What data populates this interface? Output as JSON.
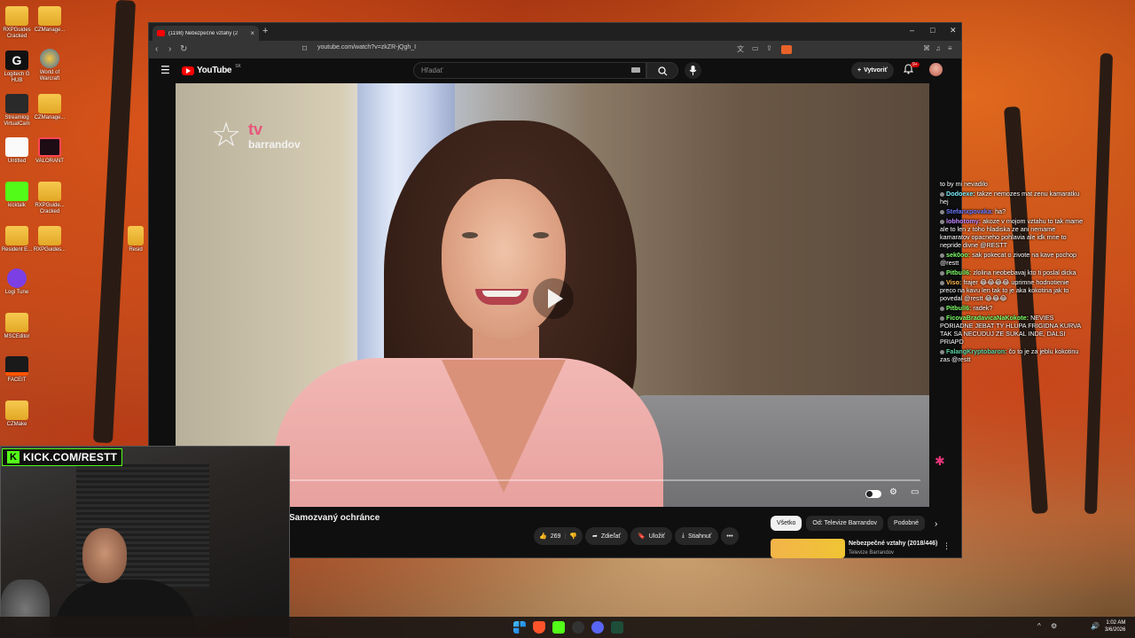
{
  "desktop": {
    "icons": [
      {
        "label": "RXPGuides Cracked"
      },
      {
        "label": "CZManage..."
      },
      {
        "label": "Logitech G HUB"
      },
      {
        "label": "World of Warcraft"
      },
      {
        "label": "Streamlog VirtualCam"
      },
      {
        "label": "CZManage..."
      },
      {
        "label": "Untitled"
      },
      {
        "label": "VALORANT"
      },
      {
        "label": "kicktalk"
      },
      {
        "label": "RXPGuide... Cracked"
      },
      {
        "label": "Resident E..."
      },
      {
        "label": "RXPGuides..."
      },
      {
        "label": "Logi Tune"
      },
      {
        "label": "MSCEditor"
      },
      {
        "label": "FACEIT"
      },
      {
        "label": "CZMake"
      },
      {
        "label": "Resid"
      }
    ]
  },
  "browser": {
    "tab_title": "(1198) Nebezpečné vztahy (2",
    "url": "youtube.com/watch?v=zkZR-jQgh_I"
  },
  "youtube": {
    "logo_text": "YouTube",
    "country_code": "SK",
    "search_placeholder": "Hľadať",
    "create_label": "Vytvoriť",
    "notification_count": "9+",
    "video": {
      "channel_logo_tv": "tv",
      "channel_logo_name": "barrandov",
      "title": "Samozvaný ochránce"
    },
    "actions": {
      "likes": "269",
      "share": "Zdieľať",
      "save": "Uložiť",
      "download": "Stiahnuť"
    },
    "chips": [
      "Všetko",
      "Od: Televize Barrandov",
      "Podobné"
    ],
    "recommendation": {
      "title": "Nebezpečné vztahy (2018/446)",
      "channel": "Televize Barrandov"
    }
  },
  "chat": [
    {
      "user": "",
      "text": "to by mi nevadilo",
      "color": "#ffffff"
    },
    {
      "user": "Dodoexe:",
      "text": " takze nemozes mat zenu kamaratku hej",
      "color": "#7ef0ff"
    },
    {
      "user": "Stefanxpovaka:",
      "text": " ha?",
      "color": "#6e7bff"
    },
    {
      "user": "lobhotomy:",
      "text": " akoze v mojom vztahu to tak mame ale to len z toho hladiska ze ani nemame kamaratov opacneho pohlavia ale idk mne to nepride divne @RESTT",
      "color": "#c38bff"
    },
    {
      "user": "sek0oo:",
      "text": " sak pokecat o zivote na kave pochop @restt",
      "color": "#7fff6a"
    },
    {
      "user": "Pitbull6:",
      "text": " zlolina neobebavaj kto ti poslal dicka",
      "color": "#7fff6a"
    },
    {
      "user": "Viso:",
      "text": " frajer 😂😂😂😂 uprimne hodnotienie preco na kavu len tak to je aka kokotina jak to povedal @restt 😂😂😂",
      "color": "#ffb84d"
    },
    {
      "user": "Pitbull6:",
      "text": " radek?",
      "color": "#7fff6a"
    },
    {
      "user": "FicovaBradavicaNaKokote:",
      "text": " NEVIES PORIADNE JEBAT TY HLUPA FRIGIDNA KURVA TAK SA NECUDUJ ZE SUKAL INDE, DALSI PRIAPD",
      "color": "#7fff6a"
    },
    {
      "user": "FalangKryptobaron:",
      "text": " čo to je za jeblu kokotinu zas @restt",
      "color": "#5ad7a6"
    }
  ],
  "overlay": {
    "kick_handle": "KICK.COM/RESTT"
  },
  "taskbar": {
    "time": "1:02 AM",
    "date": "3/6/2026"
  },
  "colors": {
    "youtube_red": "#ff0000",
    "kick_green": "#53fc18"
  }
}
